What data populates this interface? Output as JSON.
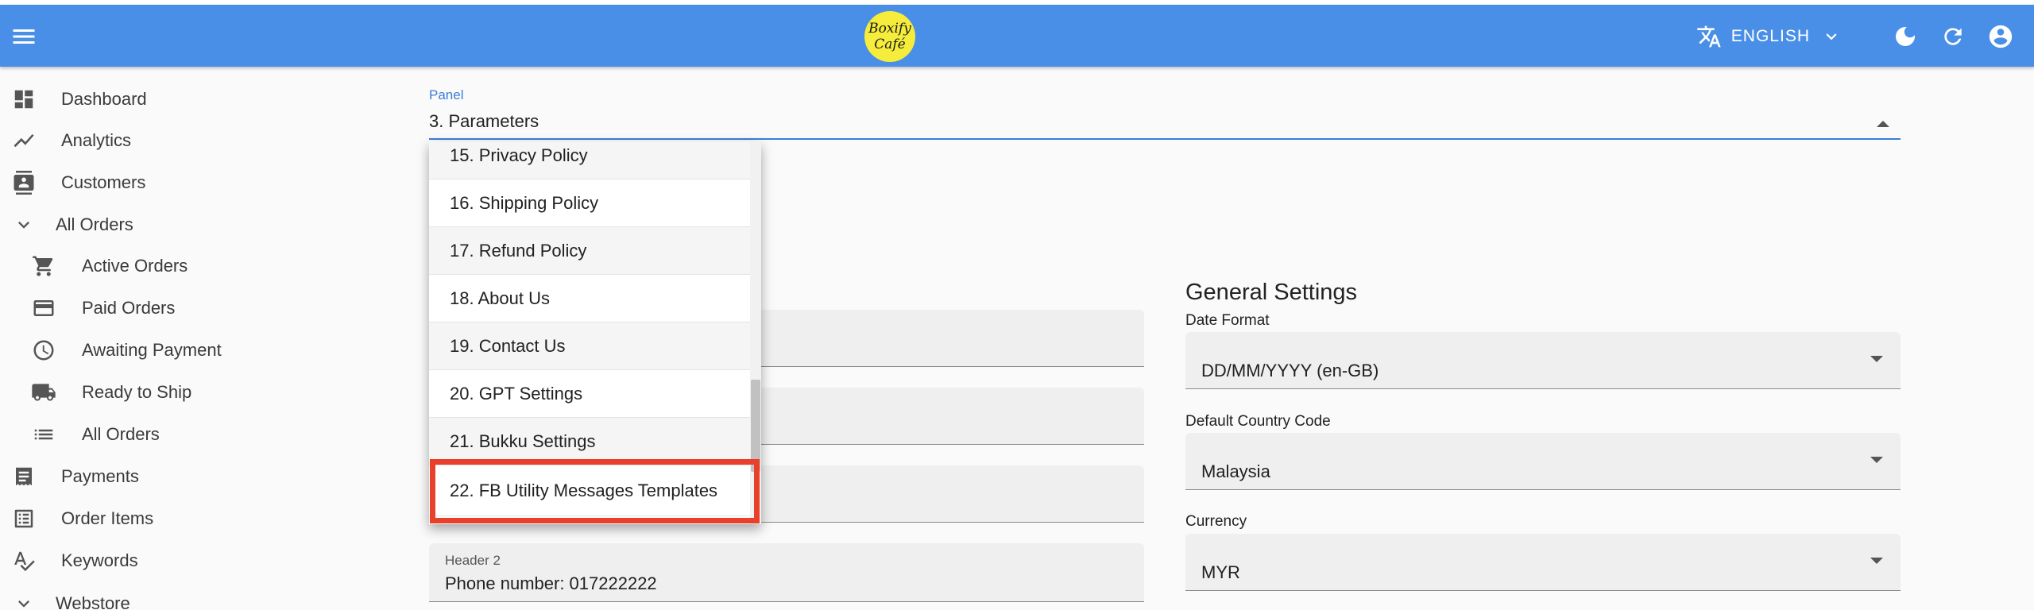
{
  "header": {
    "logo_line1": "Boxify",
    "logo_line2": "Café",
    "language": "ENGLISH",
    "icons": [
      "menu-icon",
      "translate-icon",
      "chevron-down-icon",
      "dark-mode-icon",
      "refresh-icon",
      "account-circle-icon"
    ]
  },
  "sidebar": {
    "items": [
      {
        "label": "Dashboard",
        "icon": "dashboard-icon"
      },
      {
        "label": "Analytics",
        "icon": "trending-icon"
      },
      {
        "label": "Customers",
        "icon": "contacts-icon"
      },
      {
        "label": "All Orders",
        "icon": "chevron-down-icon"
      },
      {
        "label": "Active Orders",
        "icon": "cart-icon"
      },
      {
        "label": "Paid Orders",
        "icon": "credit-card-icon"
      },
      {
        "label": "Awaiting Payment",
        "icon": "clock-icon"
      },
      {
        "label": "Ready to Ship",
        "icon": "truck-icon"
      },
      {
        "label": "All Orders",
        "icon": "list-icon"
      },
      {
        "label": "Payments",
        "icon": "receipt-icon"
      },
      {
        "label": "Order Items",
        "icon": "list-box-icon"
      },
      {
        "label": "Keywords",
        "icon": "spellcheck-icon"
      },
      {
        "label": "Webstore",
        "icon": "chevron-down-icon"
      }
    ]
  },
  "panel": {
    "label": "Panel",
    "value": "3. Parameters",
    "options": [
      "15. Privacy Policy",
      "16. Shipping Policy",
      "17. Refund Policy",
      "18. About Us",
      "19. Contact Us",
      "20. GPT Settings",
      "21. Bukku Settings",
      "22. FB Utility Messages Templates"
    ]
  },
  "left_form": {
    "header2_label": "Header 2",
    "header2_value": "Phone number: 017222222"
  },
  "general_settings": {
    "title": "General Settings",
    "date_format_label": "Date Format",
    "date_format_value": "DD/MM/YYYY (en-GB)",
    "country_code_label": "Default Country Code",
    "country_code_value": "Malaysia",
    "currency_label": "Currency",
    "currency_value": "MYR"
  },
  "colors": {
    "appbar": "#4a8fe7",
    "accent": "#3b7dd8",
    "highlight": "#e8402a",
    "logo": "#f5ec3b"
  }
}
